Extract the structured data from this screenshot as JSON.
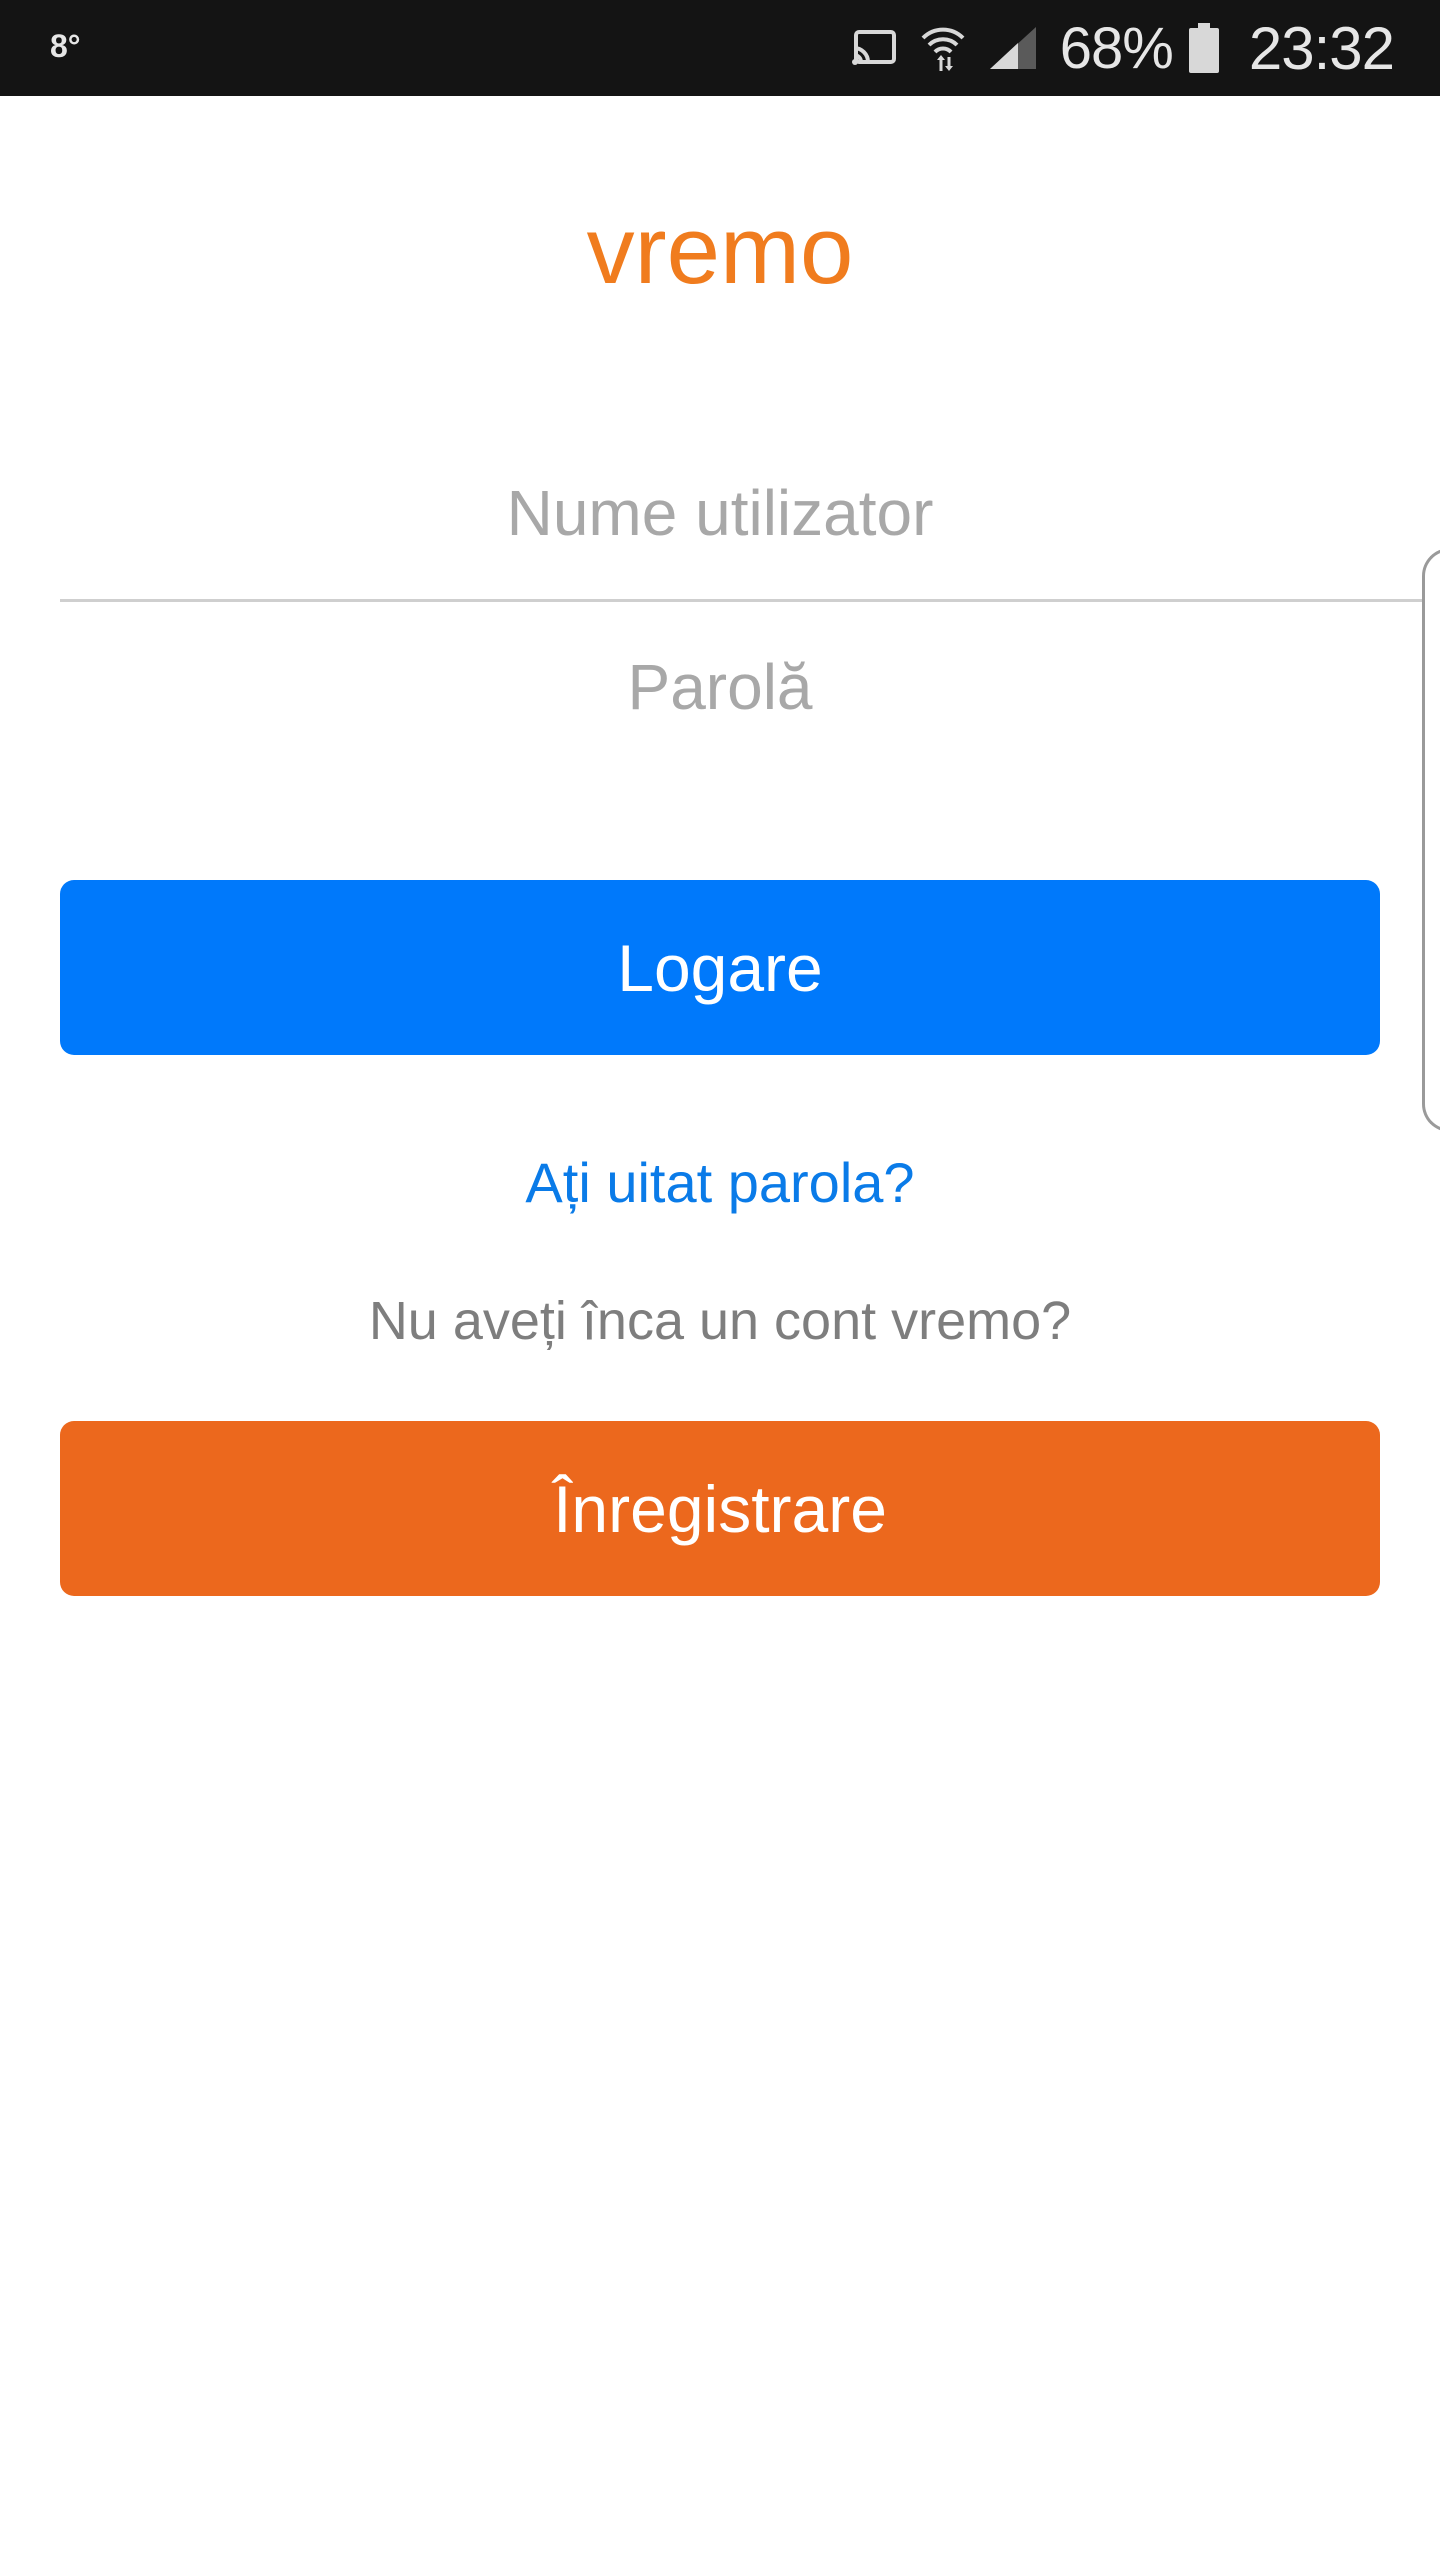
{
  "status_bar": {
    "temperature": "8°",
    "battery_percent": "68%",
    "time": "23:32",
    "icons": [
      "cast-icon",
      "wifi-icon",
      "signal-icon",
      "battery-icon"
    ]
  },
  "logo": {
    "text": "vremo",
    "color": "#f07c1e"
  },
  "login_form": {
    "username_placeholder": "Nume utilizator",
    "username_value": "",
    "password_placeholder": "Parolă",
    "password_value": "",
    "login_button": "Logare",
    "forgot_password": "Ați uitat parola?",
    "no_account_text": "Nu aveți înca un cont vremo?",
    "register_button": "Înregistrare"
  },
  "colors": {
    "login_button": "#0079fb",
    "register_button": "#ec681d",
    "link": "#0a7be8"
  }
}
